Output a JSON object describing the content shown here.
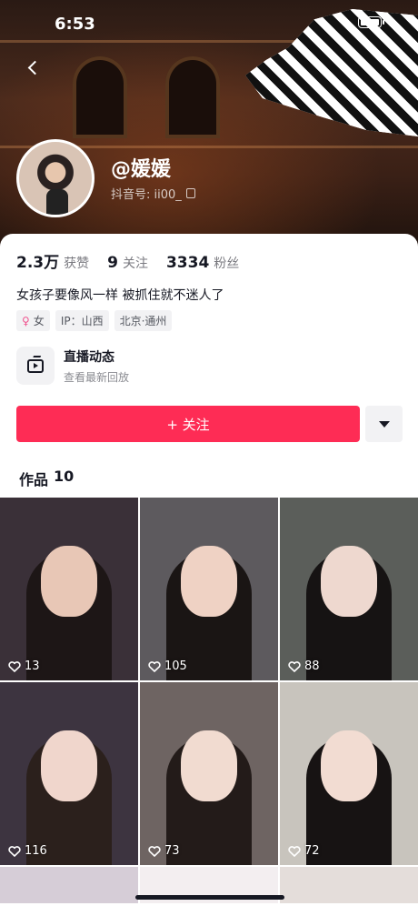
{
  "status_bar": {
    "time": "6:53"
  },
  "profile": {
    "nickname": "@媛媛",
    "douyin_id_label": "抖音号: ii00_",
    "stats": [
      {
        "value": "2.3万",
        "label": "获赞"
      },
      {
        "value": "9",
        "label": "关注"
      },
      {
        "value": "3334",
        "label": "粉丝"
      }
    ],
    "bio": "女孩子要像风一样  被抓住就不迷人了",
    "tags": [
      {
        "icon": "female-icon",
        "text": "女"
      },
      {
        "text": "IP：山西"
      },
      {
        "text": "北京·通州"
      }
    ]
  },
  "live": {
    "title": "直播动态",
    "subtitle": "查看最新回放",
    "icon": "tv-icon"
  },
  "actions": {
    "follow_label": "+ 关注",
    "more_icon": "triangle-down-icon"
  },
  "works": {
    "tab_label": "作品",
    "count": "10",
    "items": [
      {
        "likes": "13",
        "bg": "#3a3038",
        "skin": "#e8c7b6",
        "hair": "#1d1616"
      },
      {
        "likes": "105",
        "bg": "#5d5a5e",
        "skin": "#efd2c4",
        "hair": "#1a1514"
      },
      {
        "likes": "88",
        "bg": "#5b5e5a",
        "skin": "#eed8cf",
        "hair": "#161313"
      },
      {
        "likes": "116",
        "bg": "#3d3440",
        "skin": "#f0d6cc",
        "hair": "#2b201c"
      },
      {
        "likes": "73",
        "bg": "#6e6462",
        "skin": "#f1dbd0",
        "hair": "#231b19"
      },
      {
        "likes": "72",
        "bg": "#c8c4bd",
        "skin": "#f2dcd2",
        "hair": "#171313"
      }
    ],
    "partial_row_colors": [
      "#d6cdd7",
      "#f3eef0",
      "#e4ddda"
    ]
  },
  "colors": {
    "accent": "#fe2c55",
    "text_primary": "#161823",
    "text_secondary": "#7a7a80"
  }
}
